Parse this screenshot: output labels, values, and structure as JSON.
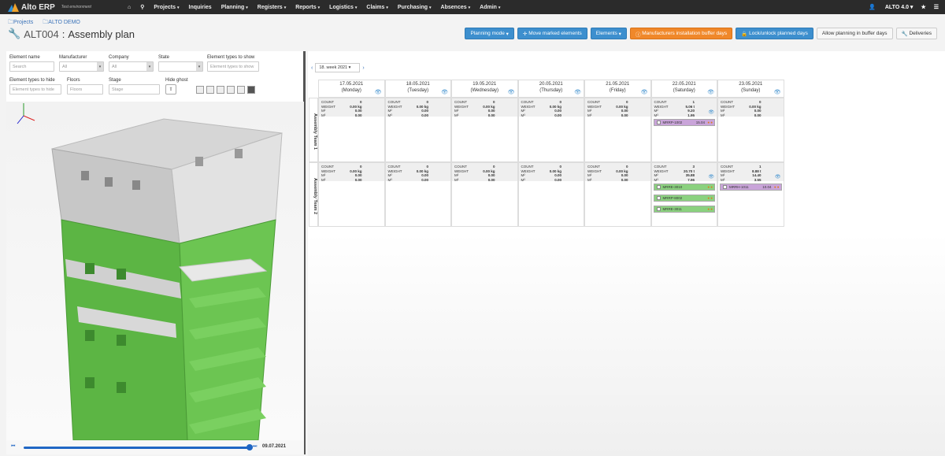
{
  "nav": {
    "brand": "Alto ERP",
    "environment": "Test environment",
    "items": [
      "Projects",
      "Inquiries",
      "Planning",
      "Registers",
      "Reports",
      "Logistics",
      "Claims",
      "Purchasing",
      "Absences",
      "Admin"
    ],
    "user": "ALTO 4.0"
  },
  "breadcrumb": [
    "Projects",
    "ALTO DEMO"
  ],
  "page": {
    "code": "ALT004",
    "separator": ":",
    "title": "Assembly plan"
  },
  "toolbar": {
    "planning_mode": "Planning mode",
    "move_marked": "Move marked elements",
    "elements": "Elements",
    "buffer_days": "Manufacturers installation buffer days",
    "lock_unlock": "Lock/unlock planned days",
    "allow_planning": "Allow planning in buffer days",
    "deliveries": "Deliveries"
  },
  "filters": {
    "element_name": {
      "label": "Element name",
      "placeholder": "Search"
    },
    "manufacturer": {
      "label": "Manufacturer",
      "value": "All"
    },
    "company": {
      "label": "Company",
      "value": "All"
    },
    "state": {
      "label": "State",
      "value": ""
    },
    "types_show": {
      "label": "Element types to show",
      "placeholder": "Element types to show"
    },
    "types_hide": {
      "label": "Element types to hide",
      "placeholder": "Element types to hide"
    },
    "floors": {
      "label": "Floors",
      "placeholder": "Floors"
    },
    "stage": {
      "label": "Stage",
      "placeholder": "Stage"
    },
    "hide_ghost": {
      "label": "Hide ghost"
    }
  },
  "player": {
    "date": "09.07.2021",
    "progress": 0.98
  },
  "week_selector": {
    "value": "18. week 2021"
  },
  "days": [
    {
      "date": "17.05.2021",
      "name": "(Monday)"
    },
    {
      "date": "18.05.2021",
      "name": "(Tuesday)"
    },
    {
      "date": "19.05.2021",
      "name": "(Wednesday)"
    },
    {
      "date": "20.05.2021",
      "name": "(Thursday)"
    },
    {
      "date": "21.05.2021",
      "name": "(Friday)"
    },
    {
      "date": "22.05.2021",
      "name": "(Saturday)"
    },
    {
      "date": "23.05.2021",
      "name": "(Sunday)"
    }
  ],
  "stat_labels": [
    "COUNT",
    "WEIGHT",
    "M²",
    "M³"
  ],
  "teams": [
    {
      "name": "Assembly Team 1",
      "stats": [
        [
          "0",
          "0.00 kg",
          "0.00",
          "0.00"
        ],
        [
          "0",
          "0.00 kg",
          "0.00",
          "0.00"
        ],
        [
          "0",
          "0.00 kg",
          "0.00",
          "0.00"
        ],
        [
          "0",
          "0.00 kg",
          "0.00",
          "0.00"
        ],
        [
          "0",
          "0.00 kg",
          "0.00",
          "0.00"
        ],
        [
          "1",
          "5.06 t",
          "9.20",
          "1.95"
        ],
        [
          "0",
          "0.00 kg",
          "0.00",
          "0.00"
        ]
      ]
    },
    {
      "name": "Assembly Team 2",
      "stats": [
        [
          "0",
          "0.00 kg",
          "0.00",
          "0.00"
        ],
        [
          "0",
          "0.00 kg",
          "0.00",
          "0.00"
        ],
        [
          "0",
          "0.00 kg",
          "0.00",
          "0.00"
        ],
        [
          "0",
          "0.00 kg",
          "0.00",
          "0.00"
        ],
        [
          "0",
          "0.00 kg",
          "0.00",
          "0.00"
        ],
        [
          "3",
          "20.70 t",
          "35.88",
          "7.96"
        ],
        [
          "1",
          "8.88 t",
          "14.40",
          "3.55"
        ]
      ]
    }
  ],
  "chips": {
    "t1_sat": [
      {
        "label": "MRRP-1002",
        "value": "15.04",
        "color": "purple"
      }
    ],
    "t2_sat": [
      {
        "label": "MRRE-3010",
        "value": "",
        "color": "green"
      },
      {
        "label": "MRRP-8002",
        "value": "",
        "color": "green"
      },
      {
        "label": "MRRE-3011",
        "value": "",
        "color": "green"
      }
    ],
    "t2_sun": [
      {
        "label": "MRRH-1011",
        "value": "10.04",
        "color": "purple"
      }
    ]
  },
  "colors": {
    "accent": "#3d8fce",
    "orange": "#f0882a",
    "green_model": "#5cb544",
    "navbar": "#2b2b2b"
  }
}
